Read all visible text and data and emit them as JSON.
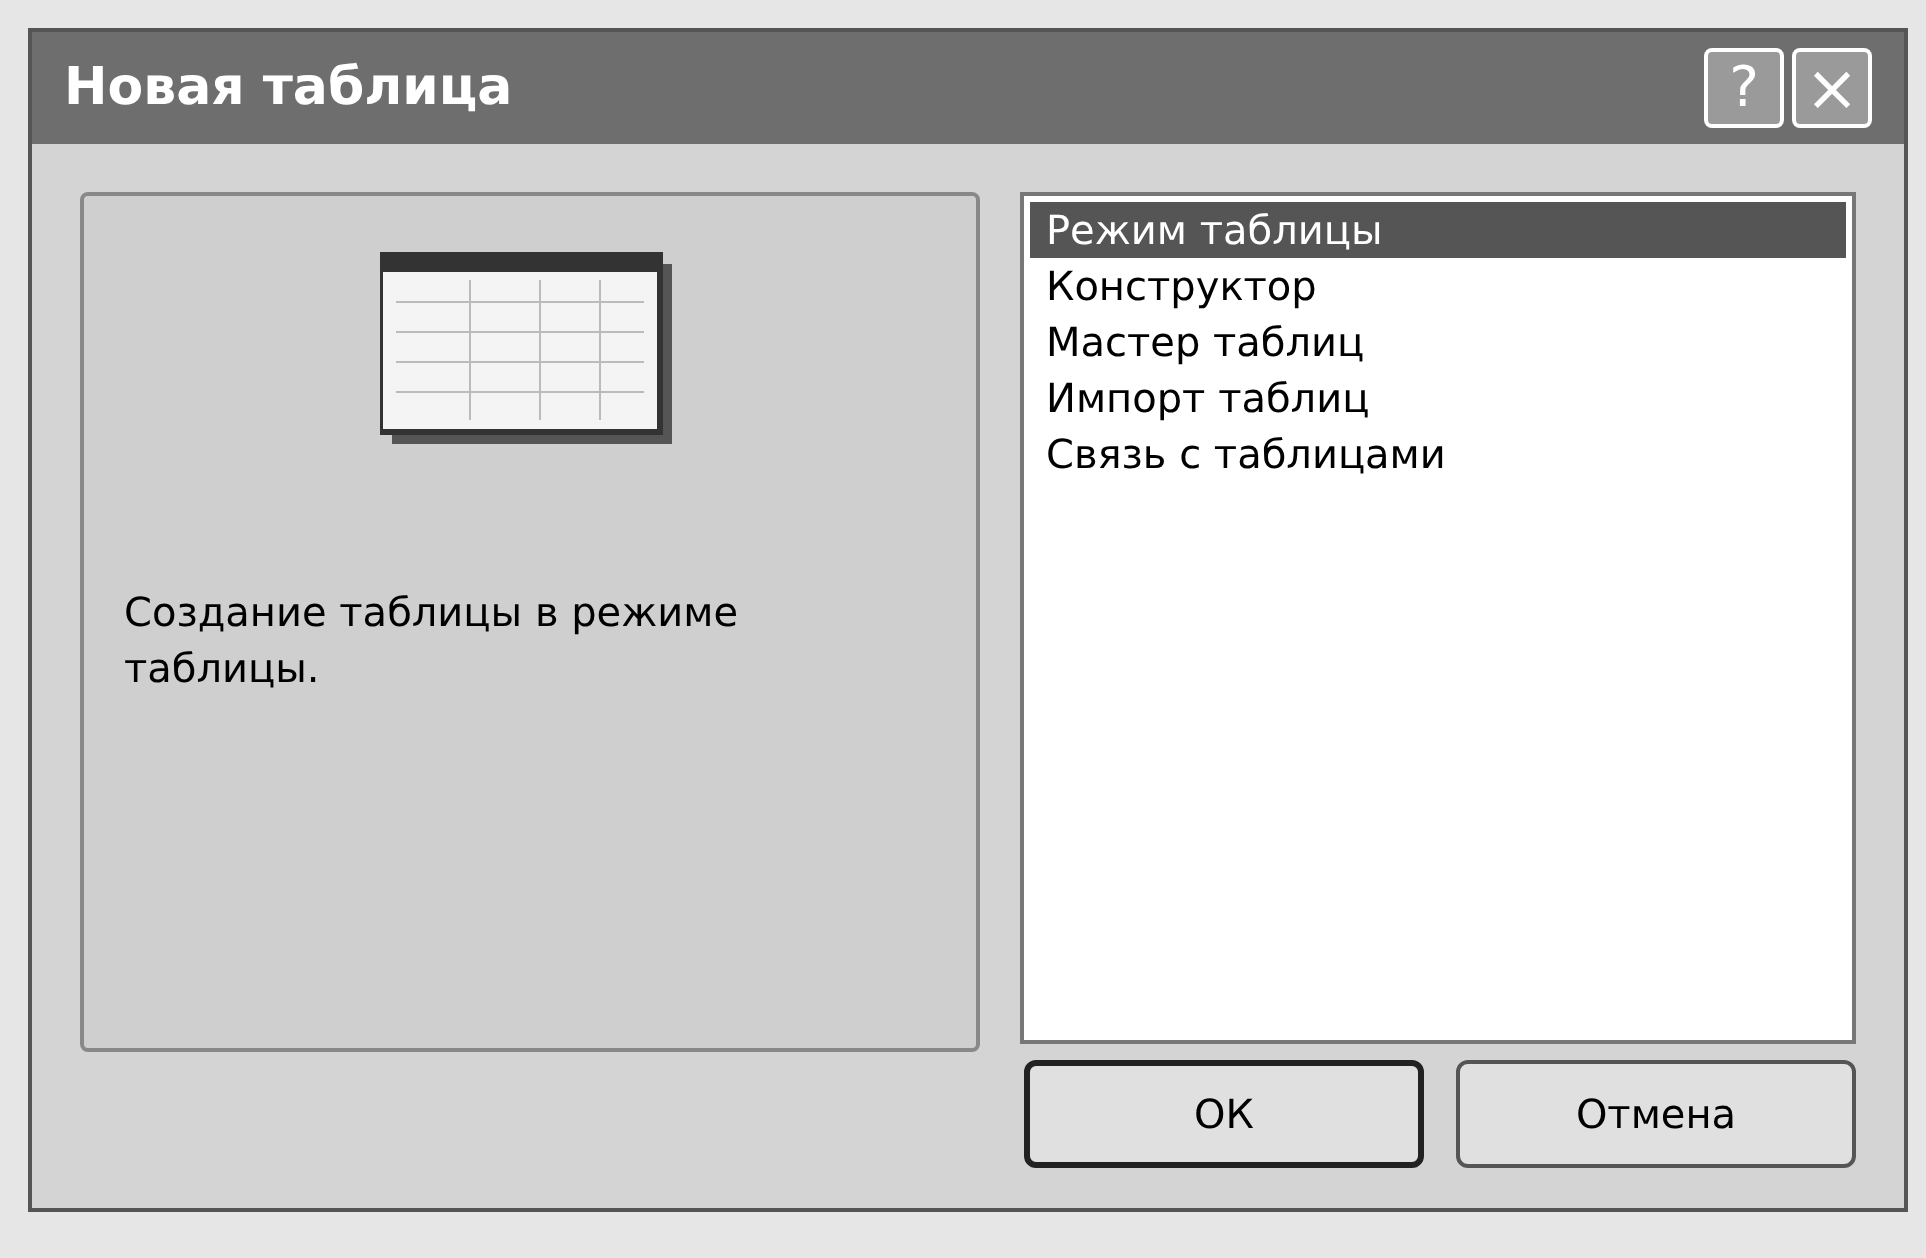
{
  "window": {
    "title": "Новая таблица",
    "help_button": "?",
    "close_button": "×"
  },
  "preview": {
    "description": "Создание таблицы в режиме таблицы."
  },
  "list": [
    {
      "label": "Режим таблицы",
      "selected": true
    },
    {
      "label": "Конструктор",
      "selected": false
    },
    {
      "label": "Мастер таблиц",
      "selected": false
    },
    {
      "label": "Импорт таблиц",
      "selected": false
    },
    {
      "label": "Связь с таблицами",
      "selected": false
    }
  ],
  "buttons": [
    {
      "label": "ОК",
      "default": true
    },
    {
      "label": "Отмена",
      "default": false
    }
  ]
}
